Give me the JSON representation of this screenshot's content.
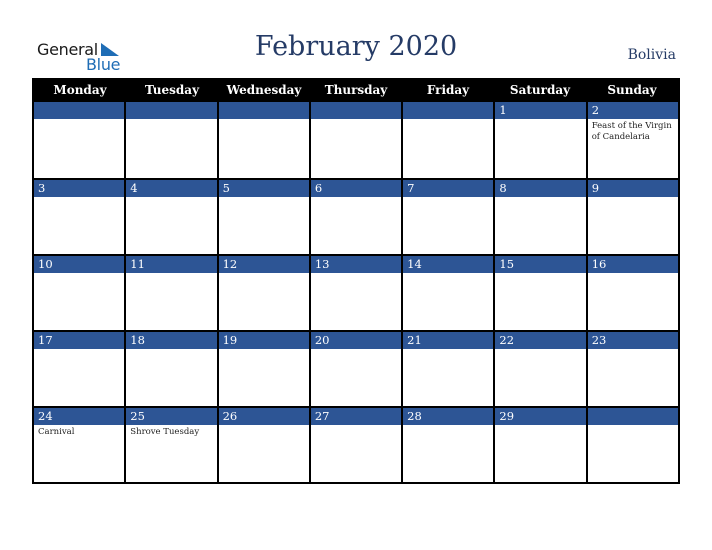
{
  "logo": {
    "general": "General",
    "blue": "Blue",
    "icon": "triangle-logo-icon",
    "accent": "#1f6db5"
  },
  "header": {
    "title": "February 2020",
    "country": "Bolivia"
  },
  "colors": {
    "title": "#253b66",
    "day_band": "#2d5595",
    "header_bg": "#000000"
  },
  "weekdays": [
    "Monday",
    "Tuesday",
    "Wednesday",
    "Thursday",
    "Friday",
    "Saturday",
    "Sunday"
  ],
  "weeks": [
    [
      {
        "day": "",
        "event": ""
      },
      {
        "day": "",
        "event": ""
      },
      {
        "day": "",
        "event": ""
      },
      {
        "day": "",
        "event": ""
      },
      {
        "day": "",
        "event": ""
      },
      {
        "day": "1",
        "event": ""
      },
      {
        "day": "2",
        "event": "Feast of the Virgin of Candelaria"
      }
    ],
    [
      {
        "day": "3",
        "event": ""
      },
      {
        "day": "4",
        "event": ""
      },
      {
        "day": "5",
        "event": ""
      },
      {
        "day": "6",
        "event": ""
      },
      {
        "day": "7",
        "event": ""
      },
      {
        "day": "8",
        "event": ""
      },
      {
        "day": "9",
        "event": ""
      }
    ],
    [
      {
        "day": "10",
        "event": ""
      },
      {
        "day": "11",
        "event": ""
      },
      {
        "day": "12",
        "event": ""
      },
      {
        "day": "13",
        "event": ""
      },
      {
        "day": "14",
        "event": ""
      },
      {
        "day": "15",
        "event": ""
      },
      {
        "day": "16",
        "event": ""
      }
    ],
    [
      {
        "day": "17",
        "event": ""
      },
      {
        "day": "18",
        "event": ""
      },
      {
        "day": "19",
        "event": ""
      },
      {
        "day": "20",
        "event": ""
      },
      {
        "day": "21",
        "event": ""
      },
      {
        "day": "22",
        "event": ""
      },
      {
        "day": "23",
        "event": ""
      }
    ],
    [
      {
        "day": "24",
        "event": "Carnival"
      },
      {
        "day": "25",
        "event": "Shrove Tuesday"
      },
      {
        "day": "26",
        "event": ""
      },
      {
        "day": "27",
        "event": ""
      },
      {
        "day": "28",
        "event": ""
      },
      {
        "day": "29",
        "event": ""
      },
      {
        "day": "",
        "event": ""
      }
    ]
  ]
}
